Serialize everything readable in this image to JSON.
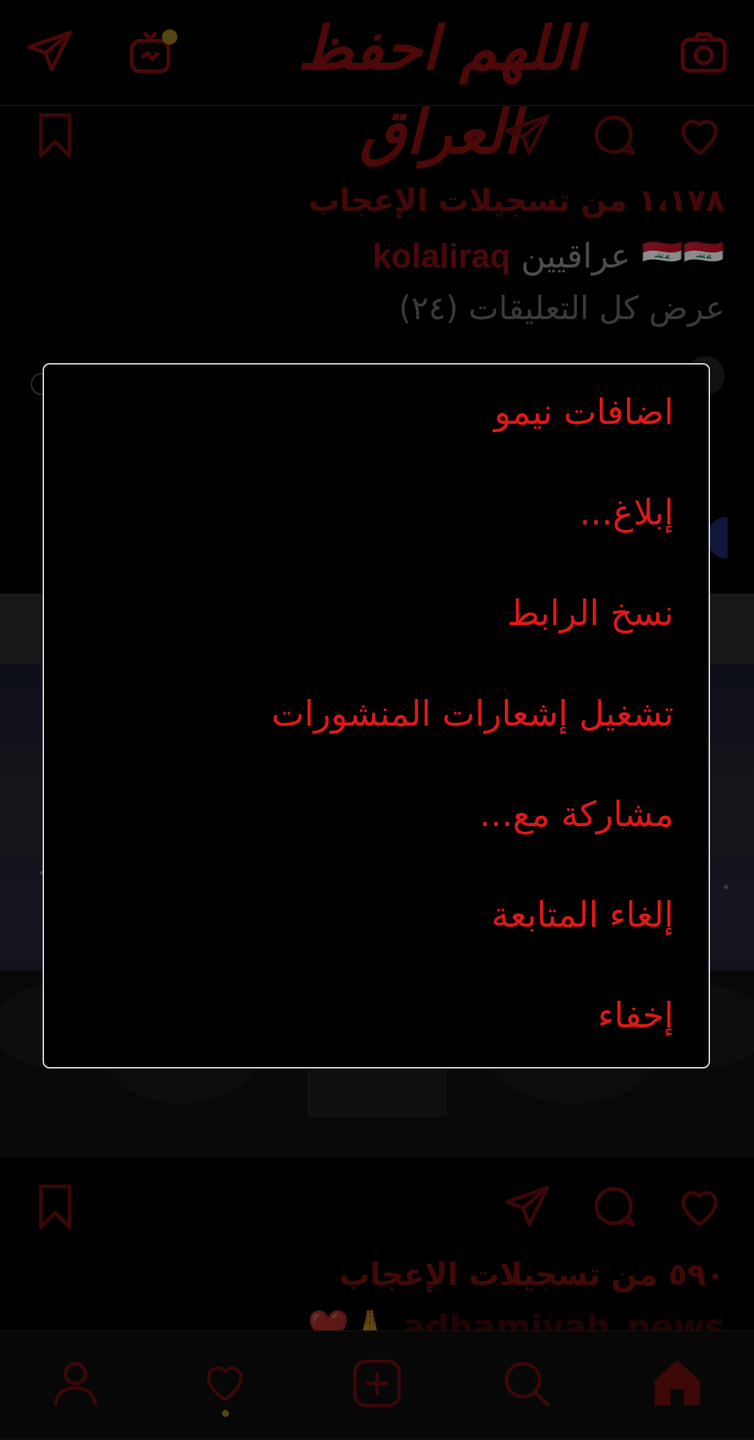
{
  "app_title": "اللهم احفظ العراق",
  "post1": {
    "likes": "١،١٧٨ من تسجيلات الإعجاب",
    "username": "kolaliraq",
    "caption_text": "عراقيين",
    "caption_flags": "🇮🇶🇮🇶",
    "view_comments": "عرض كل التعليقات (٢٤)"
  },
  "post2": {
    "likes": "٥٩٠ من تسجيلات الإعجاب",
    "caption": "adhamiyah_news 🙏❤️"
  },
  "menu": {
    "items": [
      {
        "label": "اضافات نيمو"
      },
      {
        "label": "إبلاغ..."
      },
      {
        "label": "نسخ الرابط"
      },
      {
        "label": "تشغيل إشعارات المنشورات"
      },
      {
        "label": "مشاركة مع..."
      },
      {
        "label": "إلغاء المتابعة"
      },
      {
        "label": "إخفاء"
      }
    ]
  },
  "colors": {
    "accent": "#a61414",
    "menu_text": "#e01818",
    "notification_dot": "#9c8224"
  }
}
